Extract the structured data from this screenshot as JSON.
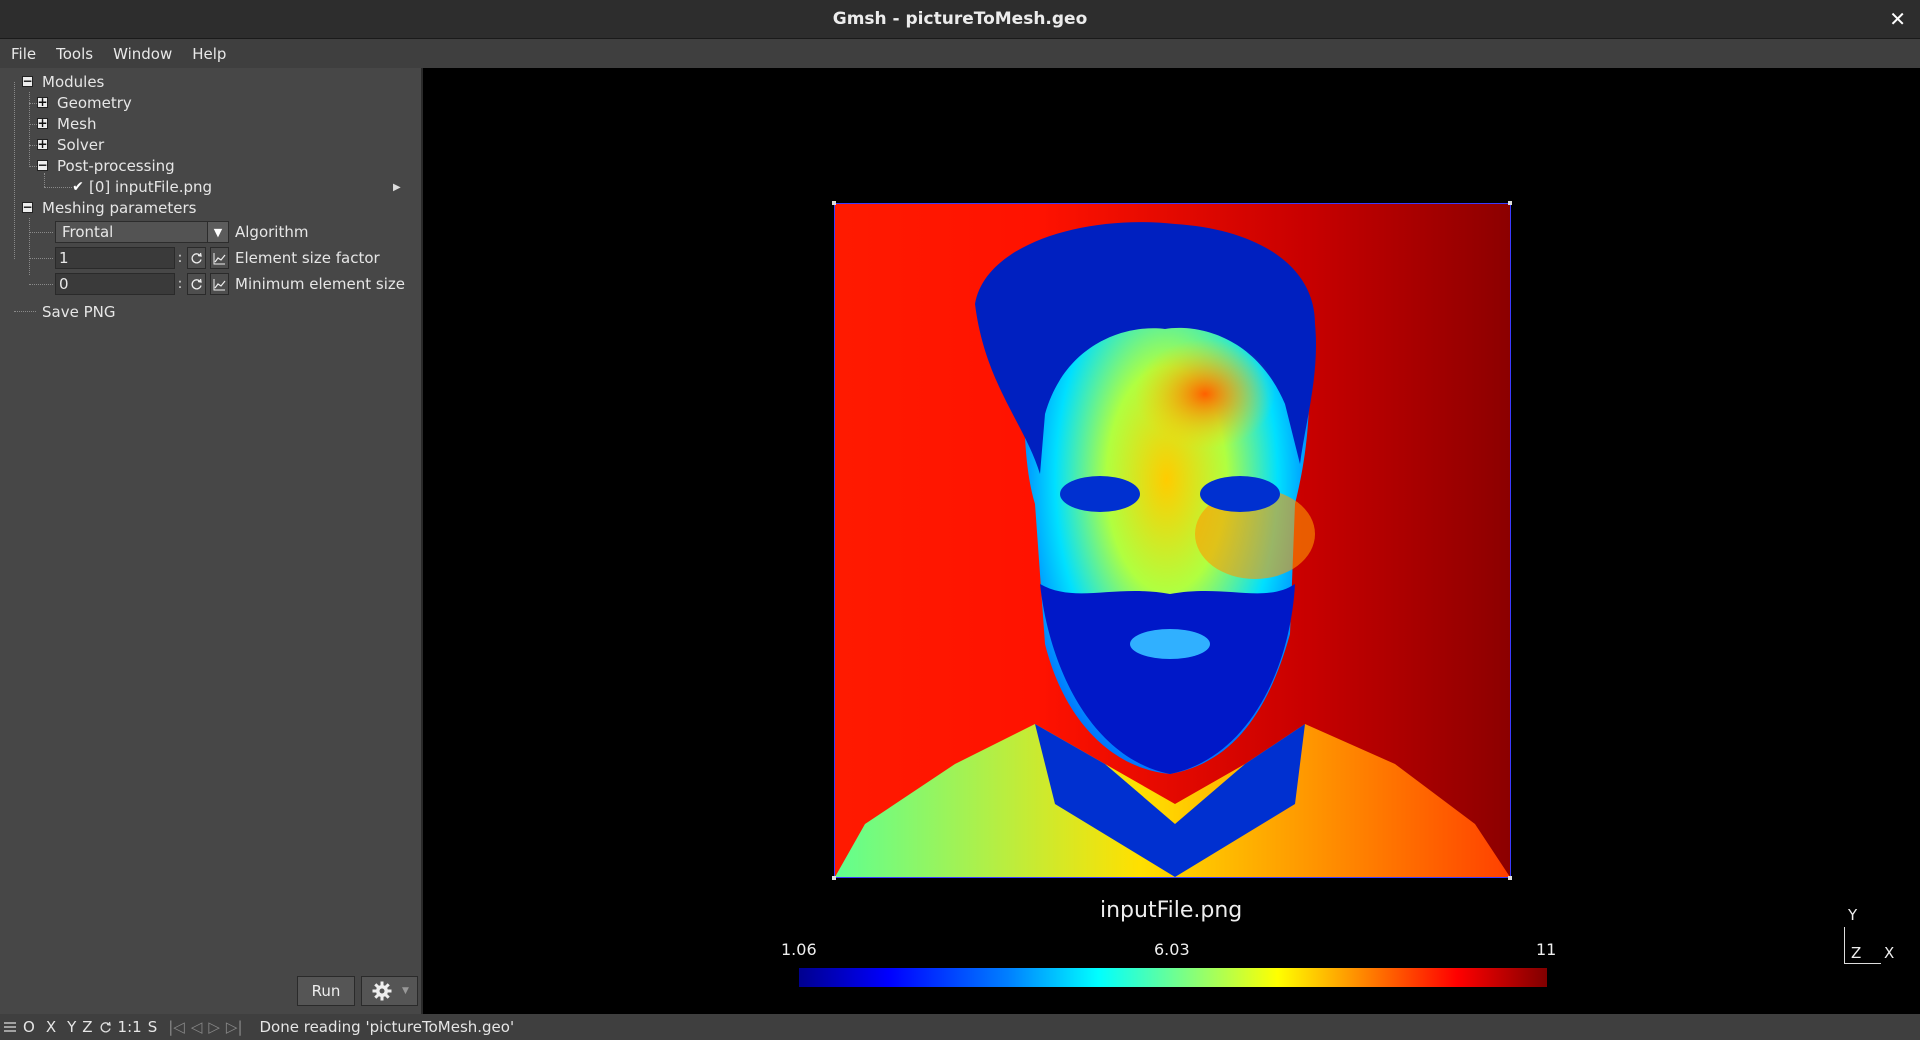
{
  "window": {
    "title": "Gmsh - pictureToMesh.geo"
  },
  "menu": [
    "File",
    "Tools",
    "Window",
    "Help"
  ],
  "tree": {
    "modules": "Modules",
    "geometry": "Geometry",
    "mesh": "Mesh",
    "solver": "Solver",
    "post_processing": "Post-processing",
    "view0": "[0] inputFile.png",
    "meshing_parameters": "Meshing parameters",
    "save_png": "Save PNG"
  },
  "params": {
    "algorithm_value": "Frontal",
    "algorithm_label": "Algorithm",
    "element_size_factor_value": "1",
    "element_size_factor_label": "Element size factor",
    "min_element_size_value": "0",
    "min_element_size_label": "Minimum element size"
  },
  "buttons": {
    "run": "Run"
  },
  "statusbar": {
    "o": "O",
    "x": "X",
    "y": "Y",
    "z": "Z",
    "scale": "1:1",
    "s": "S",
    "message": "Done reading 'pictureToMesh.geo'"
  },
  "view": {
    "title": "inputFile.png",
    "colorbar_min": "1.06",
    "colorbar_mid": "6.03",
    "colorbar_max": "11"
  },
  "axes": {
    "y": "Y",
    "z": "Z",
    "x": "X"
  }
}
